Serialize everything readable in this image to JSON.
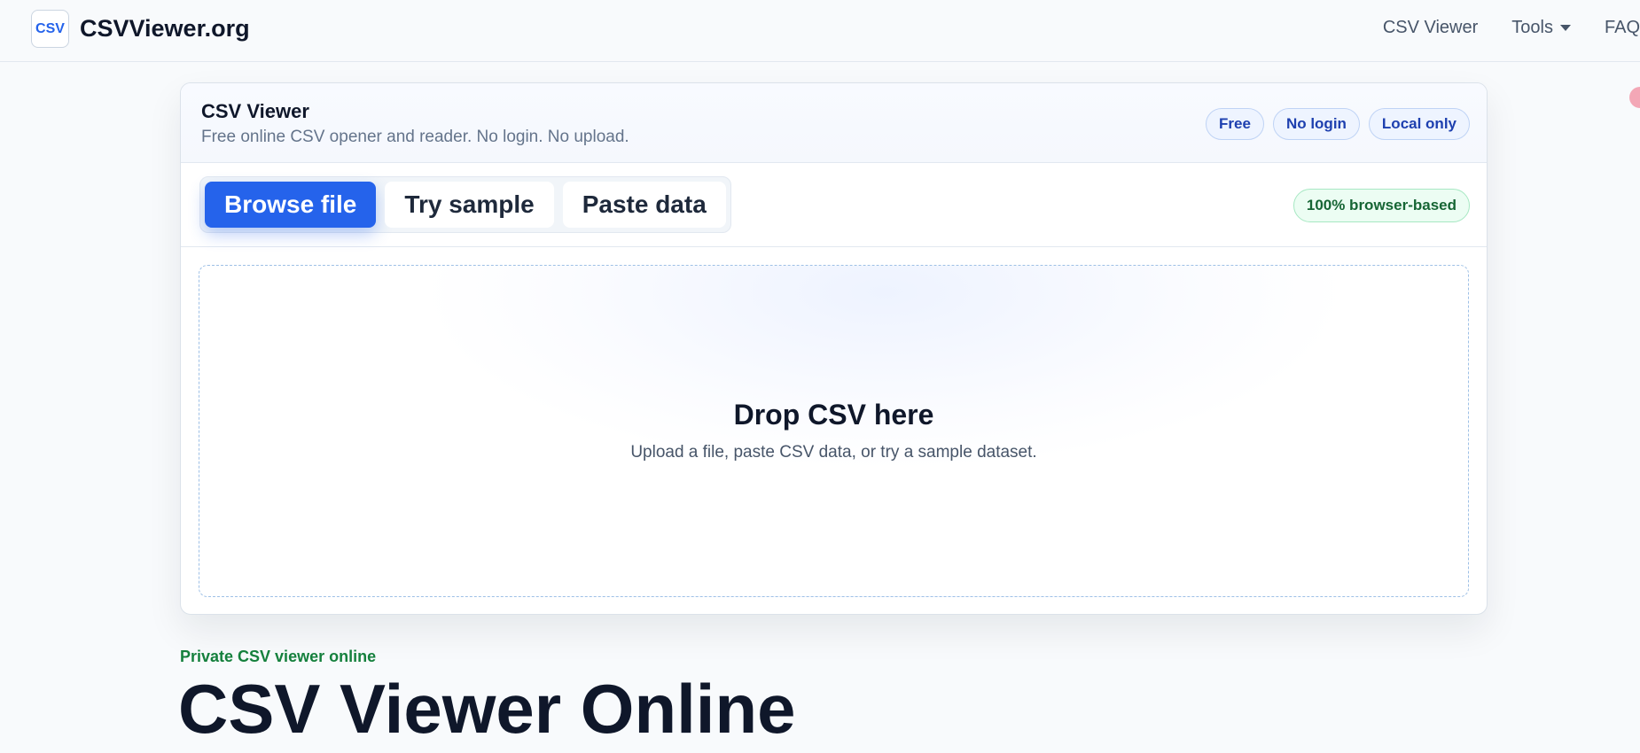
{
  "nav": {
    "logo_text": "CSV",
    "brand": "CSVViewer.org",
    "links": [
      "CSV Viewer",
      "Tools",
      "FAQ"
    ]
  },
  "card": {
    "title": "CSV Viewer",
    "subtitle": "Free online CSV opener and reader. No login. No upload.",
    "pills": [
      "Free",
      "No login",
      "Local only"
    ],
    "actions": {
      "browse": "Browse file",
      "sample": "Try sample",
      "paste": "Paste data",
      "active": "Browse file"
    },
    "browser_badge": "100% browser-based",
    "dropzone": {
      "title": "Drop CSV here",
      "subtitle": "Upload a file, paste CSV data, or try a sample dataset."
    }
  },
  "hero": {
    "eyebrow": "Private CSV viewer online",
    "title": "CSV Viewer Online"
  },
  "colors": {
    "accent": "#2563eb",
    "success": "#15803d",
    "text": "#0f172a"
  }
}
